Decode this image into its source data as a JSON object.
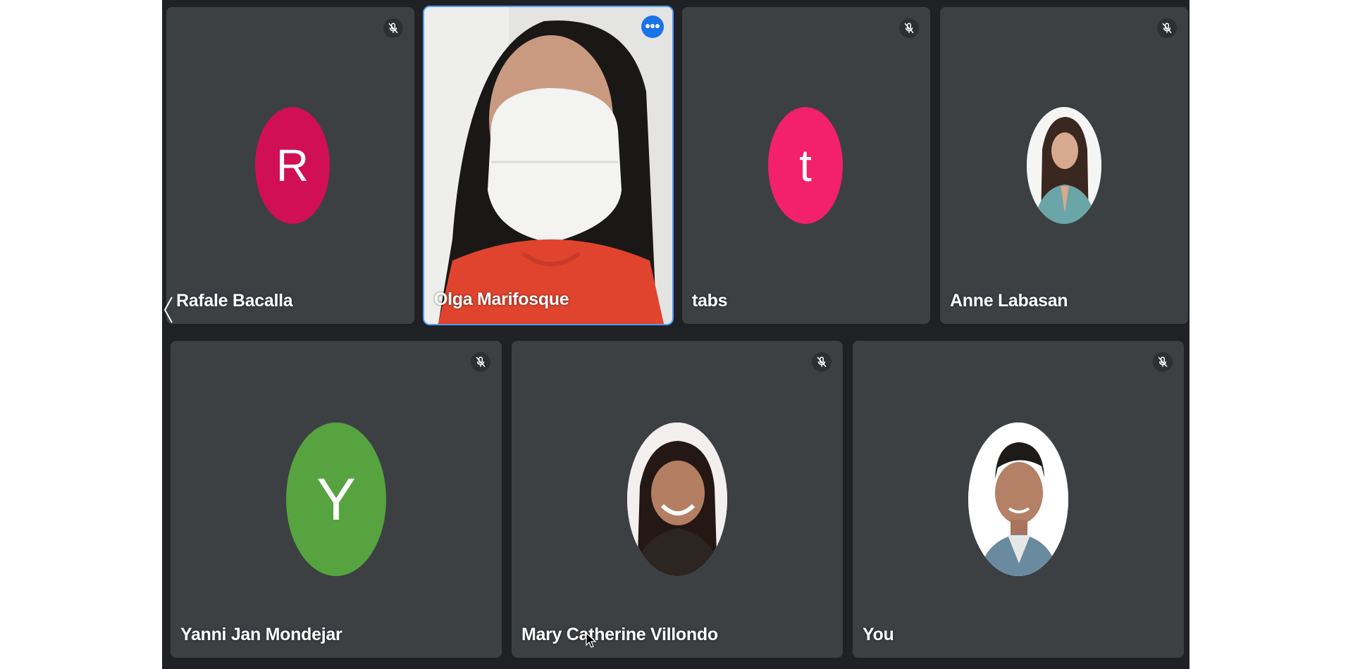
{
  "colors": {
    "stage_bg": "#202124",
    "tile_bg": "#3c4043",
    "active_border": "#4f9cf5",
    "avatar_r": "#d10f55",
    "avatar_t": "#f2216a",
    "avatar_y": "#56a33f",
    "more_button": "#1a73e8"
  },
  "participants": [
    {
      "name": "Rafale Bacalla",
      "avatar_type": "initial",
      "initial": "R",
      "muted": true
    },
    {
      "name": "Olga Marifosque",
      "avatar_type": "video",
      "active_speaker": true
    },
    {
      "name": "tabs",
      "avatar_type": "initial",
      "initial": "t",
      "muted": true
    },
    {
      "name": "Anne Labasan",
      "avatar_type": "photo",
      "muted": true
    },
    {
      "name": "Yanni Jan Mondejar",
      "avatar_type": "initial",
      "initial": "Y",
      "muted": true
    },
    {
      "name": "Mary Catherine Villondo",
      "avatar_type": "photo",
      "muted": true
    },
    {
      "name": "You",
      "avatar_type": "photo",
      "muted": true
    }
  ],
  "icons": {
    "muted": "mic-off-icon",
    "more": "more-options-icon",
    "prev": "chevron-left-icon"
  }
}
